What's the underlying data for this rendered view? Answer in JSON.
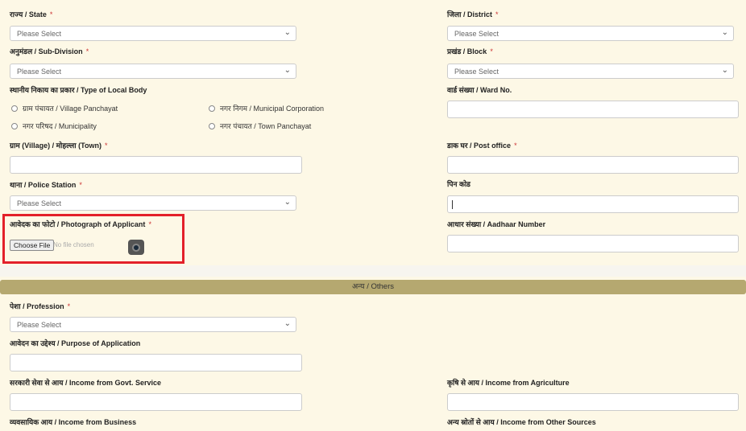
{
  "placeholder_select": "Please Select",
  "left": {
    "state": "राज्य / State",
    "subdivision": "अनुमंडल / Sub-Division",
    "local_body": "स्थानीय निकाय का प्रकार / Type of Local Body",
    "radios": [
      "ग्राम पंचायत / Village Panchayat",
      "नगर निगम / Municipal Corporation",
      "नगर परिषद / Municipality",
      "नगर पंचायत / Town Panchayat"
    ],
    "village": "ग्राम (Village) / मोहल्ला (Town)",
    "police": "थाना / Police Station",
    "photo": "आवेदक का फोटो / Photograph of Applicant",
    "choose_file": "Choose File",
    "no_file": "No file chosen"
  },
  "right": {
    "district": "जिला / District",
    "block": "प्रखंड / Block",
    "ward": "वार्ड संख्या / Ward No.",
    "post_office": "डाक घर / Post office",
    "pin": "पिन कोड",
    "aadhaar": "आधार संख्या / Aadhaar Number"
  },
  "others": {
    "title": "अन्य / Others",
    "profession": "पेशा / Profession",
    "purpose": "आवेदन का उद्देश्य / Purpose of Application",
    "income_govt": "सरकारी सेवा से आय / Income from Govt. Service",
    "income_agri": "कृषि से आय / Income from Agriculture",
    "income_business": "व्यवसायिक आय / Income from Business",
    "income_other": "अन्य स्रोतों से आय / Income from Other Sources"
  },
  "required_mark": "*",
  "highlight_color": "#e3202a",
  "section_color": "#b5a870"
}
